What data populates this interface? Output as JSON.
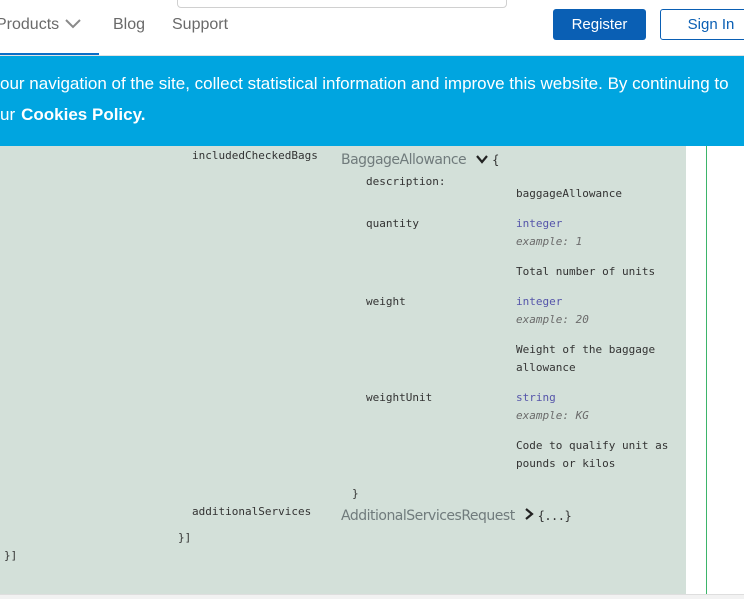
{
  "header": {
    "nav": {
      "products": "Products",
      "blog": "Blog",
      "support": "Support"
    },
    "register": "Register",
    "signin": "Sign In"
  },
  "cookie": {
    "line1": "our navigation of the site, collect statistical information and improve this website. By continuing to",
    "line2_prefix": "ur",
    "policy_link": "Cookies Policy."
  },
  "schema": {
    "included": {
      "key": "includedCheckedBags",
      "model": "BaggageAllowance",
      "open_brace": "{",
      "props": {
        "description": {
          "key": "description:",
          "text": "baggageAllowance"
        },
        "quantity": {
          "key": "quantity",
          "type": "integer",
          "example": "example: 1",
          "desc1": "Total number of units"
        },
        "weight": {
          "key": "weight",
          "type": "integer",
          "example": "example: 20",
          "desc1": "Weight of the baggage",
          "desc2": "allowance"
        },
        "weightUnit": {
          "key": "weightUnit",
          "type": "string",
          "example": "example: KG",
          "desc1": "Code to qualify unit as",
          "desc2": "pounds or kilos"
        }
      },
      "close_brace": "}"
    },
    "additional": {
      "key": "additionalServices",
      "model": "AdditionalServicesRequest",
      "collapsed": "{...}"
    },
    "close_inner": "}]",
    "close_outer": "}]"
  }
}
